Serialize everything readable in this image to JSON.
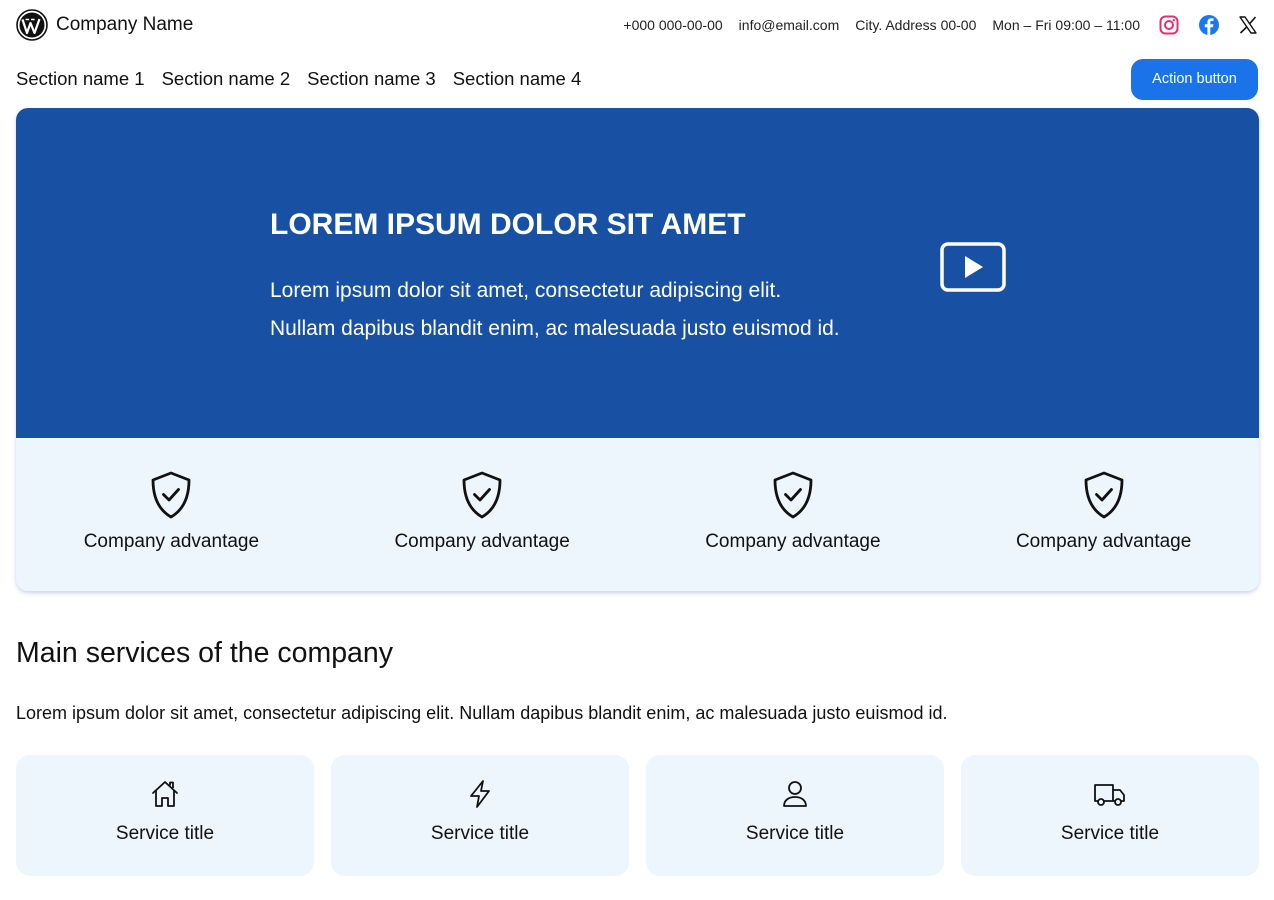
{
  "header": {
    "company_name": "Company Name",
    "logo_icon": "wordpress-icon",
    "phone": "+000 000-00-00",
    "email": "info@email.com",
    "address": "City. Address 00-00",
    "hours": "Mon – Fri 09:00 – 11:00",
    "socials": [
      "instagram-icon",
      "facebook-icon",
      "x-icon"
    ]
  },
  "nav": {
    "items": [
      "Section name 1",
      "Section name 2",
      "Section name 3",
      "Section name 4"
    ],
    "action_label": "Action button"
  },
  "hero": {
    "title": "LOREM IPSUM DOLOR SIT AMET",
    "line1": "Lorem ipsum dolor sit amet, consectetur adipiscing elit.",
    "line2": "Nullam dapibus blandit enim, ac malesuada justo euismod id.",
    "play_icon": "play-icon"
  },
  "advantages": [
    {
      "label": "Company advantage",
      "icon": "shield-check-icon"
    },
    {
      "label": "Company advantage",
      "icon": "shield-check-icon"
    },
    {
      "label": "Company advantage",
      "icon": "shield-check-icon"
    },
    {
      "label": "Company advantage",
      "icon": "shield-check-icon"
    }
  ],
  "services": {
    "title": "Main services of the company",
    "description": "Lorem ipsum dolor sit amet, consectetur adipiscing elit. Nullam dapibus blandit enim, ac malesuada justo euismod id.",
    "items": [
      {
        "title": "Service title",
        "icon": "home-icon"
      },
      {
        "title": "Service title",
        "icon": "lightning-icon"
      },
      {
        "title": "Service title",
        "icon": "user-icon"
      },
      {
        "title": "Service title",
        "icon": "truck-icon"
      }
    ]
  },
  "colors": {
    "accent": "#1a73e8",
    "hero_background": "#1851a3",
    "light_panel": "#edf5fd",
    "instagram": "#e1306c",
    "facebook": "#1877f2"
  }
}
